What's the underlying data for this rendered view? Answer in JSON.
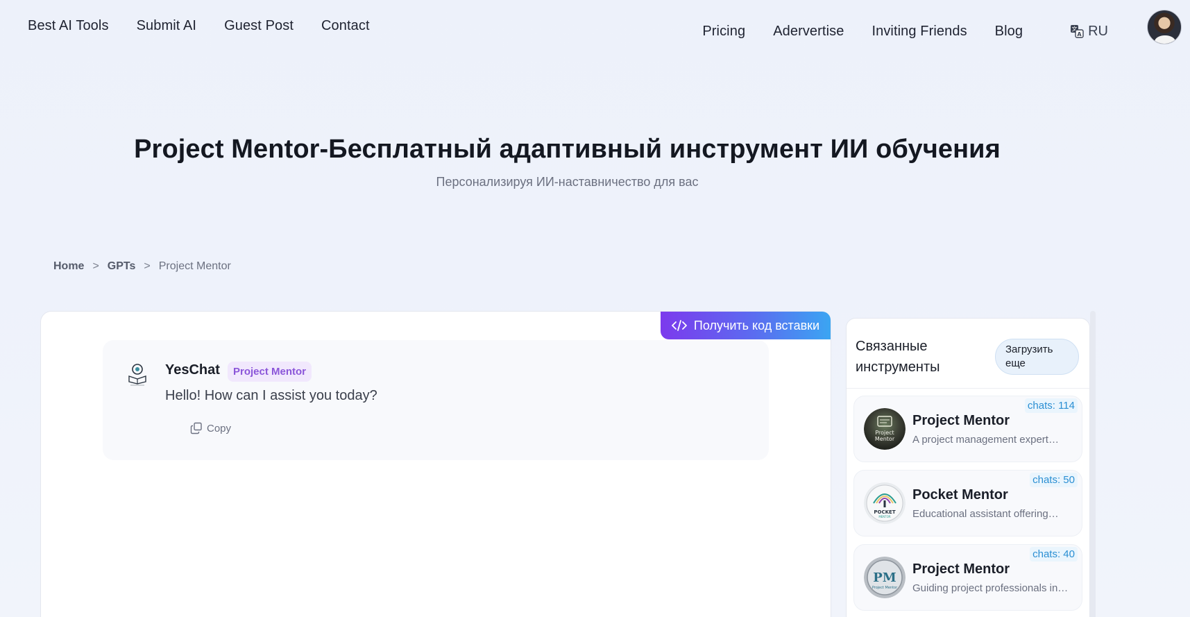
{
  "nav": {
    "left": [
      "Best AI Tools",
      "Submit AI",
      "Guest Post",
      "Contact"
    ],
    "right": [
      "Pricing",
      "Adervertise",
      "Inviting Friends",
      "Blog"
    ],
    "lang": "RU"
  },
  "hero": {
    "title": "Project Mentor-Бесплатный адаптивный инструмент ИИ обучения",
    "subtitle": "Персонализируя ИИ-наставничество для вас"
  },
  "breadcrumb": {
    "home": "Home",
    "sep1": ">",
    "gpts": "GPTs",
    "sep2": ">",
    "current": "Project Mentor"
  },
  "embed": {
    "label": "Получить код вставки"
  },
  "chat": {
    "bot_name": "YesChat",
    "bot_tag": "Project Mentor",
    "message": "Hello! How can I assist you today?",
    "copy_label": "Copy"
  },
  "sidebar": {
    "title": "Связанные инструменты",
    "load_more": "Загрузить еще",
    "tools": [
      {
        "chats": "chats: 114",
        "name": "Project Mentor",
        "desc": "A project management expert…"
      },
      {
        "chats": "chats: 50",
        "name": "Pocket Mentor",
        "desc": "Educational assistant offering…"
      },
      {
        "chats": "chats: 40",
        "name": "Project Mentor",
        "desc": "Guiding project professionals in…"
      }
    ]
  },
  "colors": {
    "accent_purple": "#7c3aed",
    "accent_blue": "#3ba5f2",
    "tag_purple": "#8b56d9",
    "chats_blue": "#2b8fd3"
  }
}
